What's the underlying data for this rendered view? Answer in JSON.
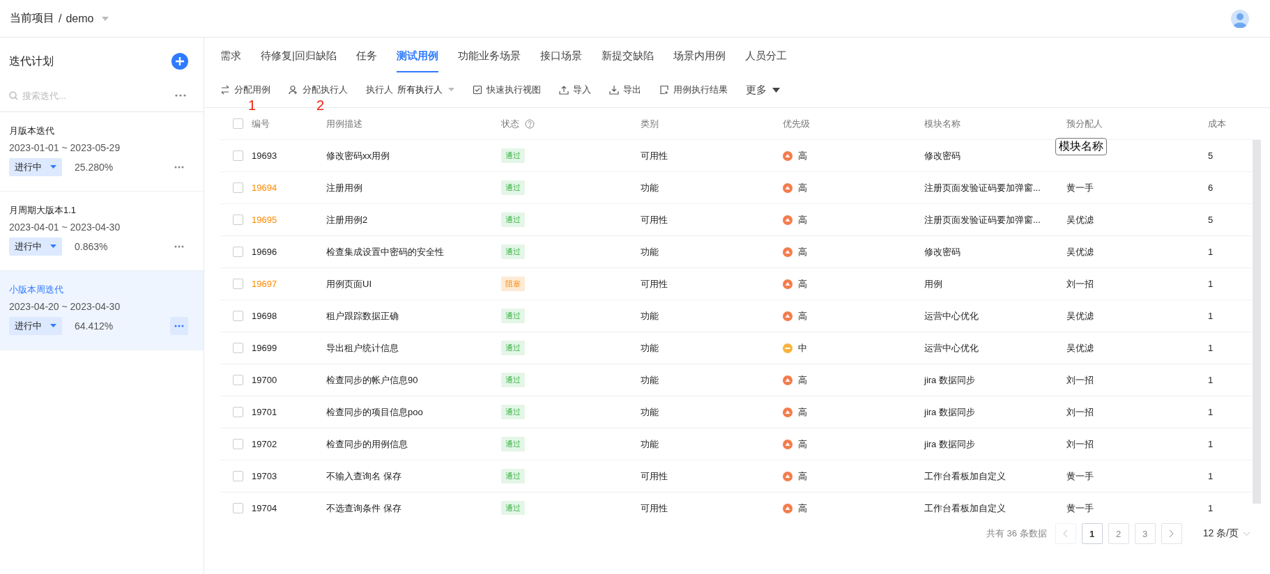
{
  "project": {
    "label": "当前项目",
    "separator": "/",
    "name": "demo"
  },
  "sidebar": {
    "title": "迭代计划",
    "search": {
      "placeholder": "搜索迭代..."
    },
    "iterations": [
      {
        "name": "月版本迭代",
        "dates": "2023-01-01 ~ 2023-05-29",
        "status": "进行中",
        "progress": "25.280%",
        "selected": false
      },
      {
        "name": "月周期大版本1.1",
        "dates": "2023-04-01 ~ 2023-04-30",
        "status": "进行中",
        "progress": "0.863%",
        "selected": false
      },
      {
        "name": "小版本周迭代",
        "dates": "2023-04-20 ~ 2023-04-30",
        "status": "进行中",
        "progress": "64.412%",
        "selected": true
      }
    ]
  },
  "tabs": [
    {
      "label": "需求",
      "selected": false
    },
    {
      "label": "待修复|回归缺陷",
      "selected": false
    },
    {
      "label": "任务",
      "selected": false
    },
    {
      "label": "测试用例",
      "selected": true
    },
    {
      "label": "功能业务场景",
      "selected": false
    },
    {
      "label": "接口场景",
      "selected": false
    },
    {
      "label": "新提交缺陷",
      "selected": false
    },
    {
      "label": "场景内用例",
      "selected": false
    },
    {
      "label": "人员分工",
      "selected": false
    }
  ],
  "toolbar": [
    {
      "kind": "action",
      "label": "分配用例",
      "annotation": "1"
    },
    {
      "kind": "action",
      "label": "分配执行人",
      "annotation": "2"
    },
    {
      "kind": "filter",
      "label": "执行人",
      "value": "所有执行人"
    },
    {
      "kind": "action",
      "label": "快速执行视图"
    },
    {
      "kind": "action",
      "label": "导入"
    },
    {
      "kind": "action",
      "label": "导出"
    },
    {
      "kind": "action",
      "label": "用例执行结果"
    },
    {
      "kind": "more",
      "label": "更多"
    }
  ],
  "table": {
    "select_all": false,
    "columns": [
      "编号",
      "用例描述",
      "状态",
      "类别",
      "优先级",
      "模块名称",
      "预分配人",
      "成本"
    ],
    "rows": [
      {
        "checked": false,
        "id": "19693",
        "flagged": false,
        "description": "修改密码xx用例",
        "status": {
          "label": "通过",
          "kind": "pass"
        },
        "category": "可用性",
        "priority": {
          "label": "高",
          "kind": "high"
        },
        "module": "修改密码",
        "cost": "5"
      },
      {
        "checked": false,
        "id": "19694",
        "flagged": true,
        "description": "注册用例",
        "status": {
          "label": "通过",
          "kind": "pass"
        },
        "category": "功能",
        "priority": {
          "label": "高",
          "kind": "high"
        },
        "module": "注册页面发验证码要加弹窗...",
        "assignee": "黄一手",
        "cost": "6"
      },
      {
        "checked": false,
        "id": "19695",
        "flagged": true,
        "description": "注册用例2",
        "status": {
          "label": "通过",
          "kind": "pass"
        },
        "category": "可用性",
        "priority": {
          "label": "高",
          "kind": "high"
        },
        "module": "注册页面发验证码要加弹窗...",
        "assignee": "吴优滤",
        "cost": "5"
      },
      {
        "checked": false,
        "id": "19696",
        "flagged": false,
        "description": "检查集成设置中密码的安全性",
        "status": {
          "label": "通过",
          "kind": "pass"
        },
        "category": "功能",
        "priority": {
          "label": "高",
          "kind": "high"
        },
        "module": "修改密码",
        "assignee": "吴优滤",
        "cost": "1"
      },
      {
        "checked": false,
        "id": "19697",
        "flagged": true,
        "description": "用例页面UI",
        "status": {
          "label": "阻塞",
          "kind": "blocked"
        },
        "category": "可用性",
        "priority": {
          "label": "高",
          "kind": "high"
        },
        "module": "用例",
        "assignee": "刘一招",
        "cost": "1"
      },
      {
        "checked": false,
        "id": "19698",
        "flagged": false,
        "description": "租户跟踪数据正确",
        "status": {
          "label": "通过",
          "kind": "pass"
        },
        "category": "功能",
        "priority": {
          "label": "高",
          "kind": "high"
        },
        "module": "运营中心优化",
        "assignee": "吴优滤",
        "cost": "1"
      },
      {
        "checked": false,
        "id": "19699",
        "flagged": false,
        "description": "导出租户统计信息",
        "status": {
          "label": "通过",
          "kind": "pass"
        },
        "category": "功能",
        "priority": {
          "label": "中",
          "kind": "medium"
        },
        "module": "运营中心优化",
        "assignee": "吴优滤",
        "cost": "1"
      },
      {
        "checked": false,
        "id": "19700",
        "flagged": false,
        "description": "检查同步的帐户信息90",
        "status": {
          "label": "通过",
          "kind": "pass"
        },
        "category": "功能",
        "priority": {
          "label": "高",
          "kind": "high"
        },
        "module": "jira 数据同步",
        "assignee": "刘一招",
        "cost": "1"
      },
      {
        "checked": false,
        "id": "19701",
        "flagged": false,
        "description": "检查同步的项目信息poo",
        "status": {
          "label": "通过",
          "kind": "pass"
        },
        "category": "功能",
        "priority": {
          "label": "高",
          "kind": "high"
        },
        "module": "jira 数据同步",
        "assignee": "刘一招",
        "cost": "1"
      },
      {
        "checked": false,
        "id": "19702",
        "flagged": false,
        "description": "检查同步的用例信息",
        "status": {
          "label": "通过",
          "kind": "pass"
        },
        "category": "功能",
        "priority": {
          "label": "高",
          "kind": "high"
        },
        "module": "jira 数据同步",
        "assignee": "刘一招",
        "cost": "1"
      },
      {
        "checked": false,
        "id": "19703",
        "flagged": false,
        "description": "不输入查询名 保存",
        "status": {
          "label": "通过",
          "kind": "pass"
        },
        "category": "可用性",
        "priority": {
          "label": "高",
          "kind": "high"
        },
        "module": "工作台看板加自定义",
        "assignee": "黄一手",
        "cost": "1"
      },
      {
        "checked": false,
        "id": "19704",
        "flagged": false,
        "description": "不选查询条件 保存",
        "status": {
          "label": "通过",
          "kind": "pass"
        },
        "category": "可用性",
        "priority": {
          "label": "高",
          "kind": "high"
        },
        "module": "工作台看板加自定义",
        "assignee": "黄一手",
        "cost": "1"
      }
    ],
    "tooltip": {
      "text": "模块名称"
    }
  },
  "pagination": {
    "total": "共有 36 条数据",
    "prev_disabled": true,
    "pages": [
      {
        "label": "1",
        "selected": true
      },
      {
        "label": "2",
        "selected": false
      },
      {
        "label": "3",
        "selected": false
      }
    ],
    "page_size": "12 条/页"
  }
}
